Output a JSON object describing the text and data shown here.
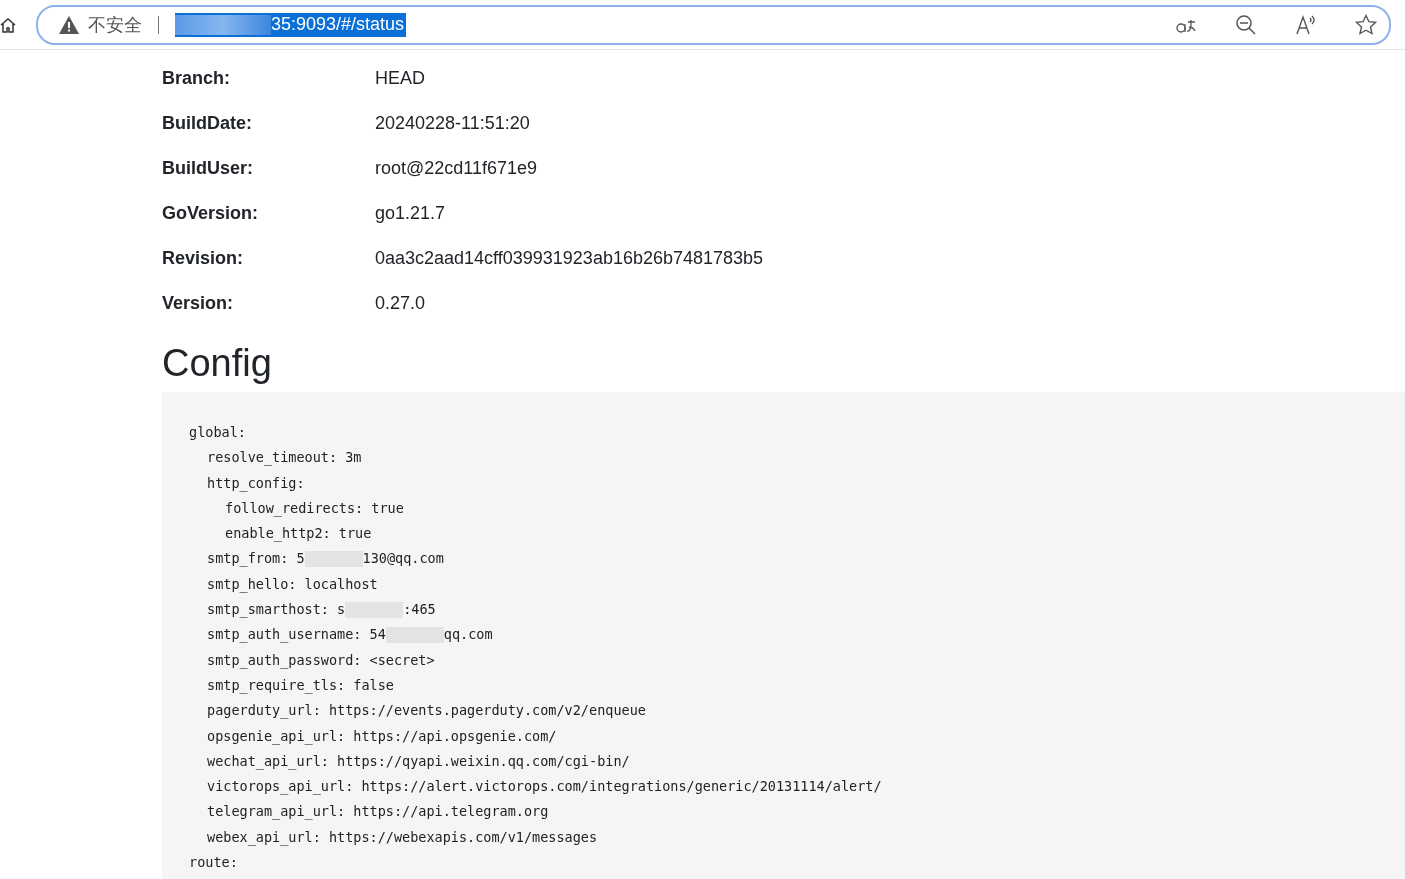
{
  "browser": {
    "security_label": "不安全",
    "url_visible": "35:9093/#/status"
  },
  "version_info": [
    {
      "label": "Branch:",
      "value": "HEAD"
    },
    {
      "label": "BuildDate:",
      "value": "20240228-11:51:20"
    },
    {
      "label": "BuildUser:",
      "value": "root@22cd11f671e9"
    },
    {
      "label": "GoVersion:",
      "value": "go1.21.7"
    },
    {
      "label": "Revision:",
      "value": "0aa3c2aad14cff039931923ab16b26b7481783b5"
    },
    {
      "label": "Version:",
      "value": "0.27.0"
    }
  ],
  "config": {
    "title": "Config",
    "lines": [
      {
        "text": "global:",
        "children": [
          {
            "text": "resolve_timeout: 3m"
          },
          {
            "text": "http_config:",
            "children": [
              {
                "text": "follow_redirects: true"
              },
              {
                "text": "enable_http2: true"
              }
            ]
          },
          {
            "text": "smtp_from: 5",
            "redacted": true,
            "after": "130@qq.com"
          },
          {
            "text": "smtp_hello: localhost"
          },
          {
            "text": "smtp_smarthost: s",
            "redacted": true,
            "after": ":465"
          },
          {
            "text": "smtp_auth_username: 54",
            "redacted": true,
            "after": "qq.com"
          },
          {
            "text": "smtp_auth_password: <secret>"
          },
          {
            "text": "smtp_require_tls: false"
          },
          {
            "text": "pagerduty_url: https://events.pagerduty.com/v2/enqueue"
          },
          {
            "text": "opsgenie_api_url: https://api.opsgenie.com/"
          },
          {
            "text": "wechat_api_url: https://qyapi.weixin.qq.com/cgi-bin/"
          },
          {
            "text": "victorops_api_url: https://alert.victorops.com/integrations/generic/20131114/alert/"
          },
          {
            "text": "telegram_api_url: https://api.telegram.org"
          },
          {
            "text": "webex_api_url: https://webexapis.com/v1/messages"
          }
        ]
      },
      {
        "text": "route:"
      }
    ]
  }
}
